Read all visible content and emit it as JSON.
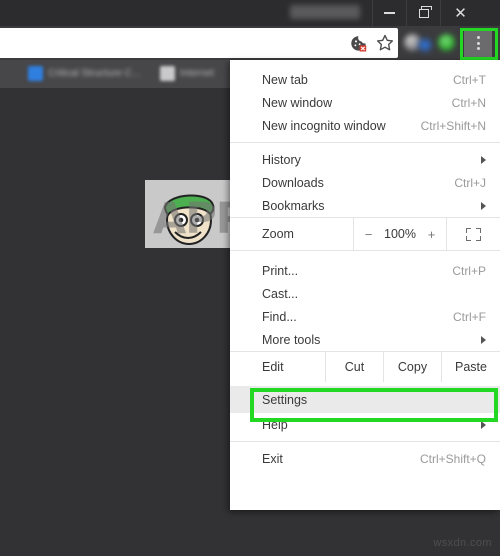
{
  "window": {
    "title": "",
    "controls": {
      "minimize": "—",
      "maximize": "❐",
      "close": "✕"
    }
  },
  "toolbar": {
    "cookie_icon": "cookie-blocked-icon",
    "star_icon": "bookmark-star-icon",
    "menu_icon": "three-dot-menu-icon"
  },
  "bookmarks_bar": {
    "items": [
      {
        "label": "Critical Structure C…"
      },
      {
        "label": "Internet"
      }
    ]
  },
  "menu": {
    "items": [
      {
        "label": "New tab",
        "shortcut": "Ctrl+T"
      },
      {
        "label": "New window",
        "shortcut": "Ctrl+N"
      },
      {
        "label": "New incognito window",
        "shortcut": "Ctrl+Shift+N"
      },
      {
        "label": "History",
        "shortcut": "",
        "arrow": true
      },
      {
        "label": "Downloads",
        "shortcut": "Ctrl+J"
      },
      {
        "label": "Bookmarks",
        "shortcut": "",
        "arrow": true
      },
      {
        "label": "Print...",
        "shortcut": "Ctrl+P"
      },
      {
        "label": "Cast...",
        "shortcut": ""
      },
      {
        "label": "Find...",
        "shortcut": "Ctrl+F"
      },
      {
        "label": "More tools",
        "shortcut": "",
        "arrow": true
      },
      {
        "label": "Settings",
        "shortcut": ""
      },
      {
        "label": "Help",
        "shortcut": "",
        "arrow": true
      },
      {
        "label": "Exit",
        "shortcut": "Ctrl+Shift+Q"
      }
    ],
    "zoom_row": {
      "label": "Zoom",
      "minus": "−",
      "value": "100%",
      "plus": "+",
      "fullscreen_icon": "fullscreen-icon"
    },
    "edit_row": {
      "label": "Edit",
      "cut": "Cut",
      "copy": "Copy",
      "paste": "Paste"
    }
  },
  "highlights": {
    "color": "#22d822",
    "targets": [
      "three-dot-menu-button",
      "settings-menu-item"
    ]
  },
  "watermarks": {
    "appuals": "APPUALS",
    "source": "wsxdn.com"
  }
}
